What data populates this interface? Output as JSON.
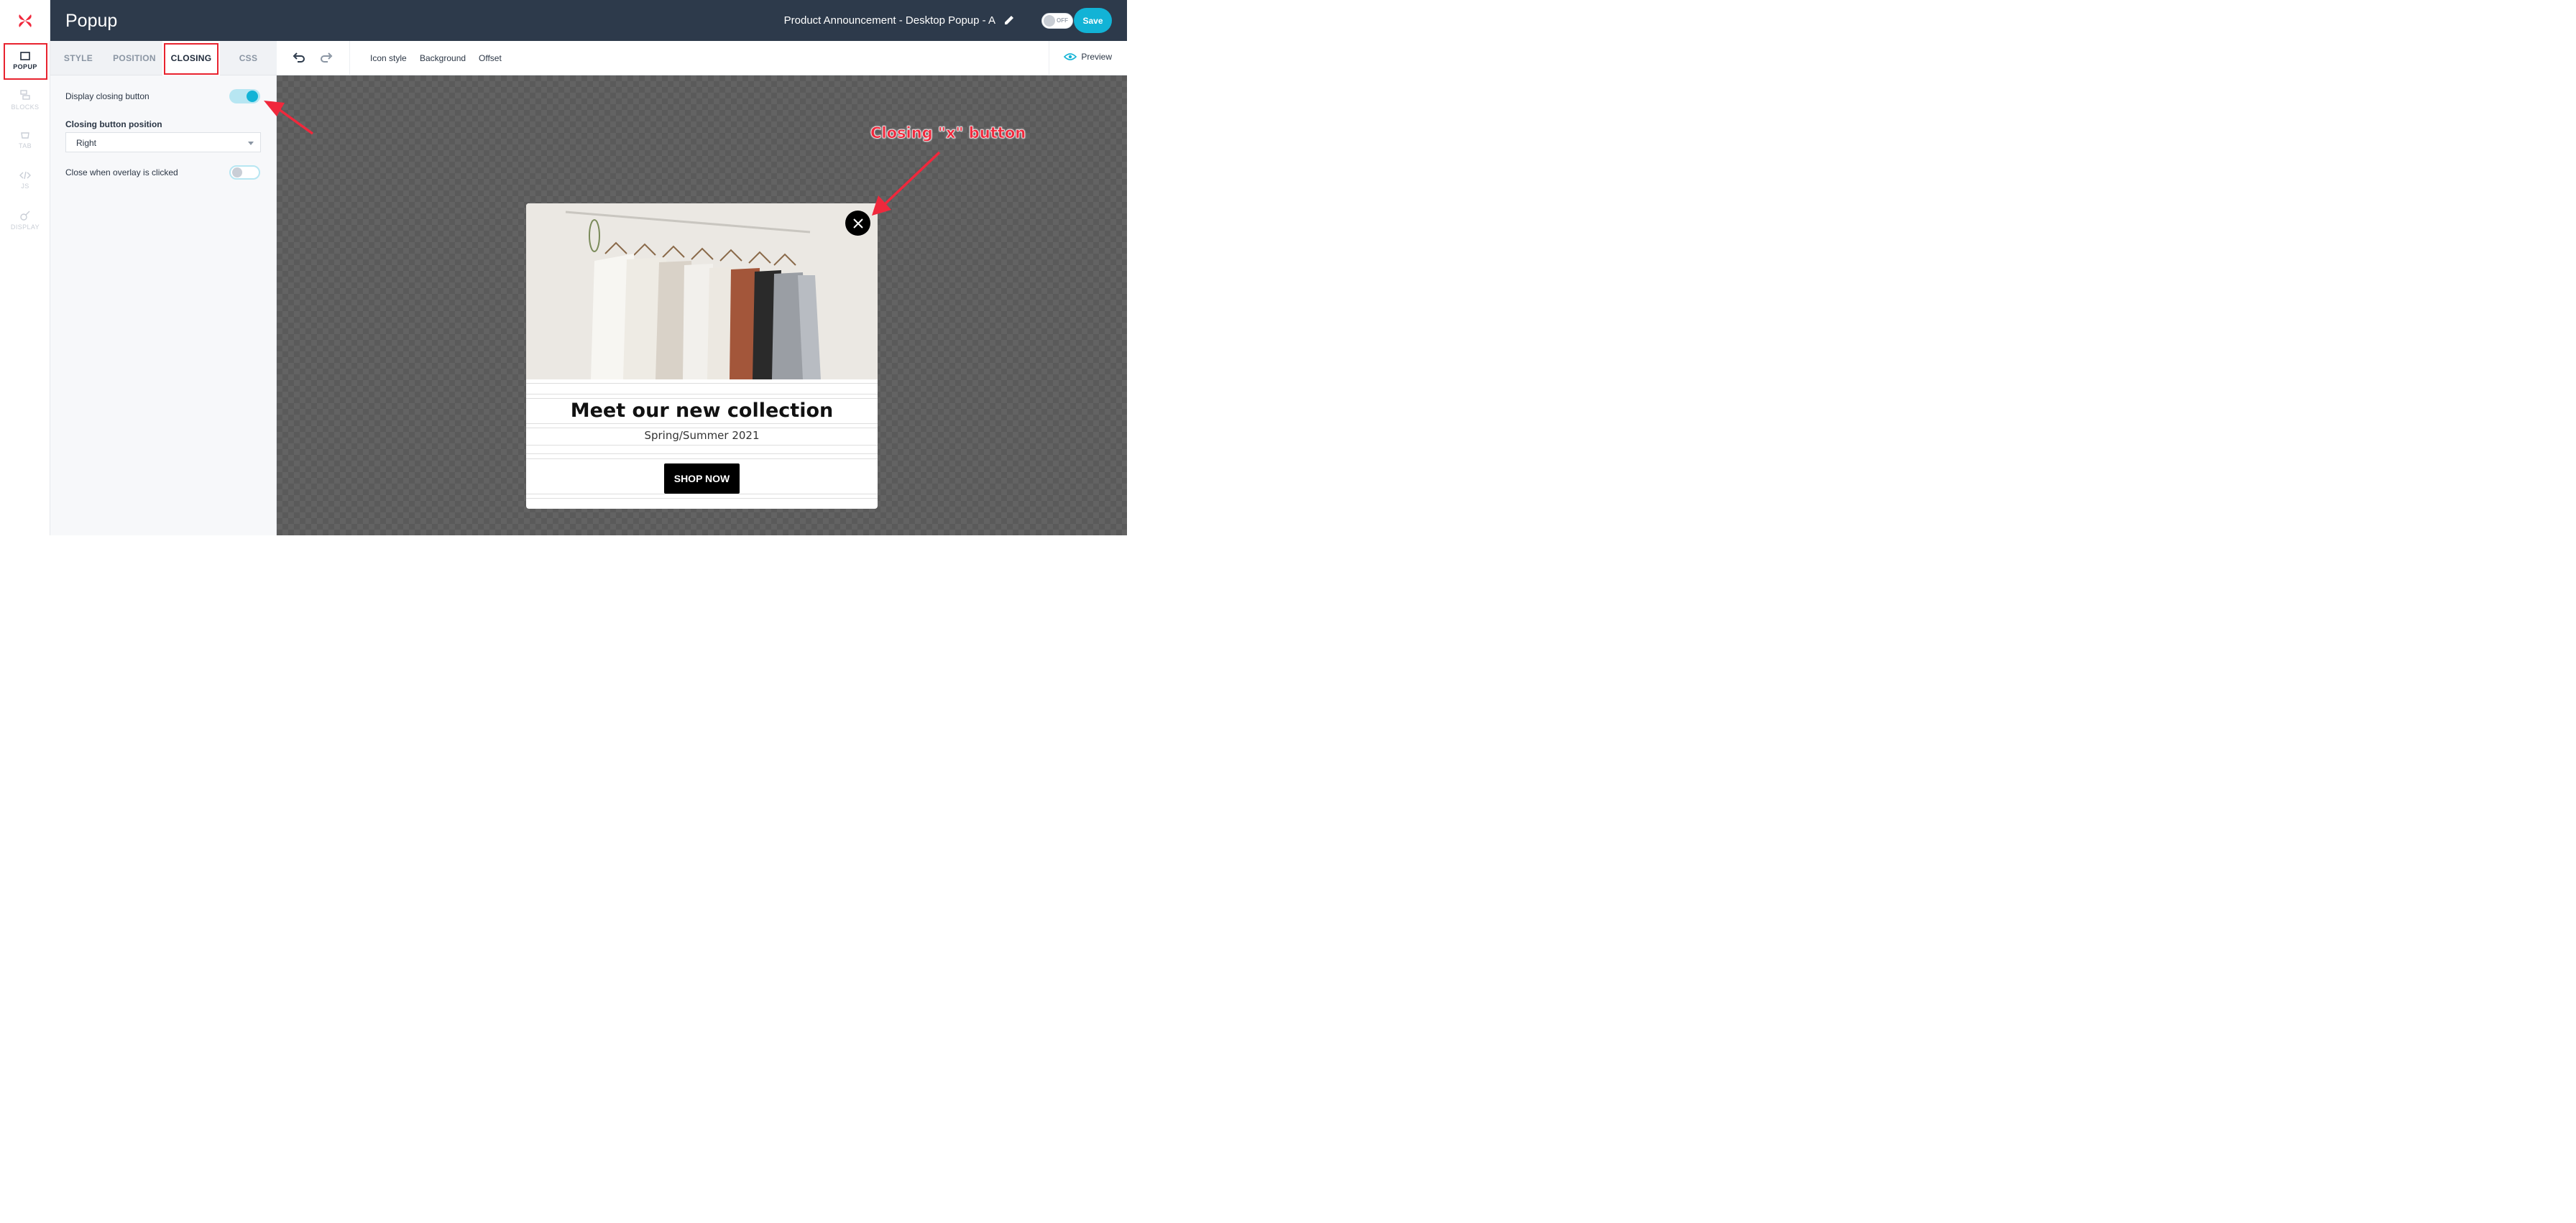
{
  "header": {
    "title": "Popup",
    "project_name": "Product Announcement - Desktop Popup - A",
    "toggle_label": "OFF",
    "save_label": "Save"
  },
  "rail": {
    "items": [
      {
        "label": "POPUP",
        "icon": "square-icon",
        "active": true
      },
      {
        "label": "BLOCKS",
        "icon": "blocks-icon"
      },
      {
        "label": "TAB",
        "icon": "tab-icon"
      },
      {
        "label": "JS",
        "icon": "code-icon"
      },
      {
        "label": "DISPLAY",
        "icon": "display-icon"
      }
    ]
  },
  "panel": {
    "tabs": [
      "STYLE",
      "POSITION",
      "CLOSING",
      "CSS"
    ],
    "active_tab": "CLOSING",
    "display_closing_label": "Display closing button",
    "display_closing_on": true,
    "position_label": "Closing button position",
    "position_value": "Right",
    "overlay_close_label": "Close when overlay is clicked",
    "overlay_close_on": false
  },
  "toolbar": {
    "links": [
      "Icon style",
      "Background",
      "Offset"
    ],
    "preview_label": "Preview"
  },
  "popup": {
    "title": "Meet our new collection",
    "subtitle": "Spring/Summer 2021",
    "button_label": "SHOP NOW"
  },
  "annotation": {
    "text": "Closing \"x\" button"
  },
  "colors": {
    "header_bg": "#2d3a4b",
    "accent": "#12b3d6",
    "highlight": "#e8232f"
  }
}
